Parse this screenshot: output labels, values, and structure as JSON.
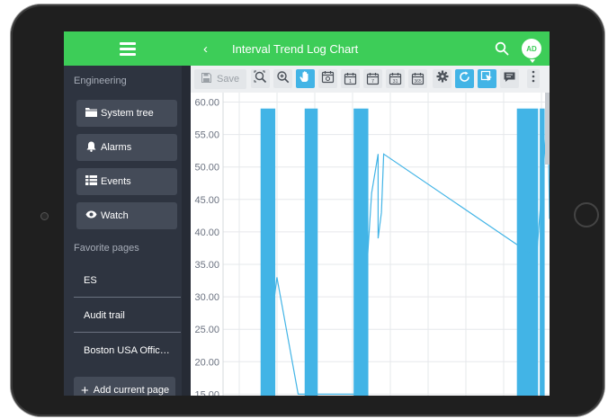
{
  "app": {
    "title": "Interval Trend Log Chart",
    "user_initials": "AD"
  },
  "sidebar": {
    "engineering_label": "Engineering",
    "nav": [
      {
        "label": "System tree",
        "icon": "folder-icon"
      },
      {
        "label": "Alarms",
        "icon": "bell-icon"
      },
      {
        "label": "Events",
        "icon": "list-icon"
      },
      {
        "label": "Watch",
        "icon": "eye-icon"
      }
    ],
    "favorites_label": "Favorite pages",
    "favorites": [
      "ES",
      "Audit trail",
      "Boston USA Offic…"
    ],
    "add_label": "Add current page"
  },
  "toolbar": {
    "save_label": "Save",
    "tools": [
      {
        "icon": "zoom-fit-icon",
        "active": false
      },
      {
        "icon": "zoom-in-icon",
        "active": false
      },
      {
        "icon": "pan-hand-icon",
        "active": true
      },
      {
        "icon": "calendar-today-icon",
        "active": false
      },
      {
        "icon": "calendar-1-day-icon",
        "active": false,
        "text": "1"
      },
      {
        "icon": "calendar-7-days-icon",
        "active": false,
        "text": "7"
      },
      {
        "icon": "calendar-31-days-icon",
        "active": false,
        "text": "31"
      },
      {
        "icon": "calendar-365-days-icon",
        "active": false,
        "text": "365"
      },
      {
        "icon": "settings-gear-icon",
        "active": false
      },
      {
        "icon": "refresh-icon",
        "active": true
      },
      {
        "icon": "select-cursor-icon",
        "active": true
      },
      {
        "icon": "comment-icon",
        "active": false
      },
      {
        "icon": "more-vertical-icon",
        "active": false
      }
    ]
  },
  "colors": {
    "green": "#3dcd58",
    "series": "#42b4e6",
    "sidebar": "#2e3440"
  },
  "chart_data": {
    "type": "line",
    "y_ticks": [
      "60.00",
      "55.00",
      "50.00",
      "45.00",
      "40.00",
      "35.00",
      "30.00",
      "25.00",
      "20.00",
      "15.00"
    ],
    "ylim": [
      15,
      61
    ],
    "xlim": [
      0,
      100
    ],
    "grid": true,
    "series": [
      {
        "points": [
          [
            14.5,
            23
          ],
          [
            15,
            27
          ],
          [
            16.5,
            33
          ],
          [
            23,
            15
          ],
          [
            42,
            15
          ],
          [
            44,
            34
          ],
          [
            45.5,
            46
          ],
          [
            47.5,
            52
          ],
          [
            47.5,
            39
          ],
          [
            48.5,
            43
          ],
          [
            49.2,
            52
          ],
          [
            96,
            36
          ],
          [
            99.5,
            59
          ],
          [
            100,
            42
          ]
        ]
      }
    ],
    "bars": [
      {
        "x0": 11.5,
        "x1": 16,
        "value": 59
      },
      {
        "x0": 25,
        "x1": 29,
        "value": 59
      },
      {
        "x0": 40,
        "x1": 44.5,
        "value": 59
      },
      {
        "x0": 90,
        "x1": 96.5,
        "value": 59
      },
      {
        "x0": 97,
        "x1": 98.5,
        "value": 59
      }
    ]
  }
}
